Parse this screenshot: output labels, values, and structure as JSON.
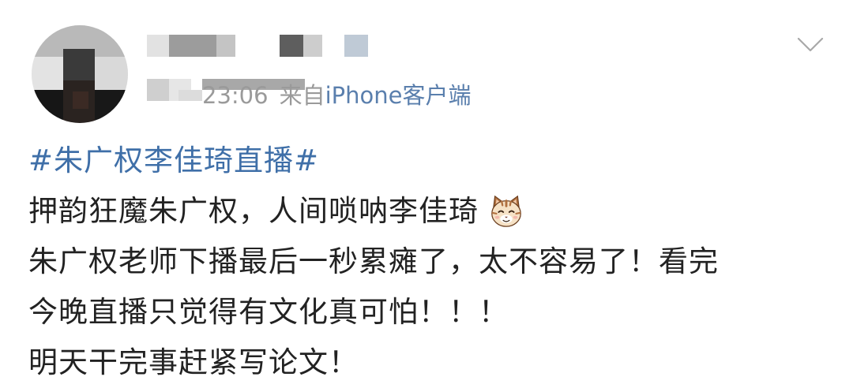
{
  "post": {
    "time": "23:06",
    "source_prefix": "来自",
    "source": "iPhone客户端",
    "topic": "#朱广权李佳琦直播#",
    "lines": [
      "押韵狂魔朱广权，人间唢呐李佳琦",
      "朱广权老师下播最后一秒累瘫了，太不容易了！看完",
      "今晚直播只觉得有文化真可怕！！！",
      "明天干完事赶紧写论文！"
    ],
    "emoji": "cat-face-emoji"
  },
  "colors": {
    "topic": "#3f6fa8",
    "source": "#5a7fad",
    "meta": "#9a9a9a",
    "text": "#222222"
  }
}
